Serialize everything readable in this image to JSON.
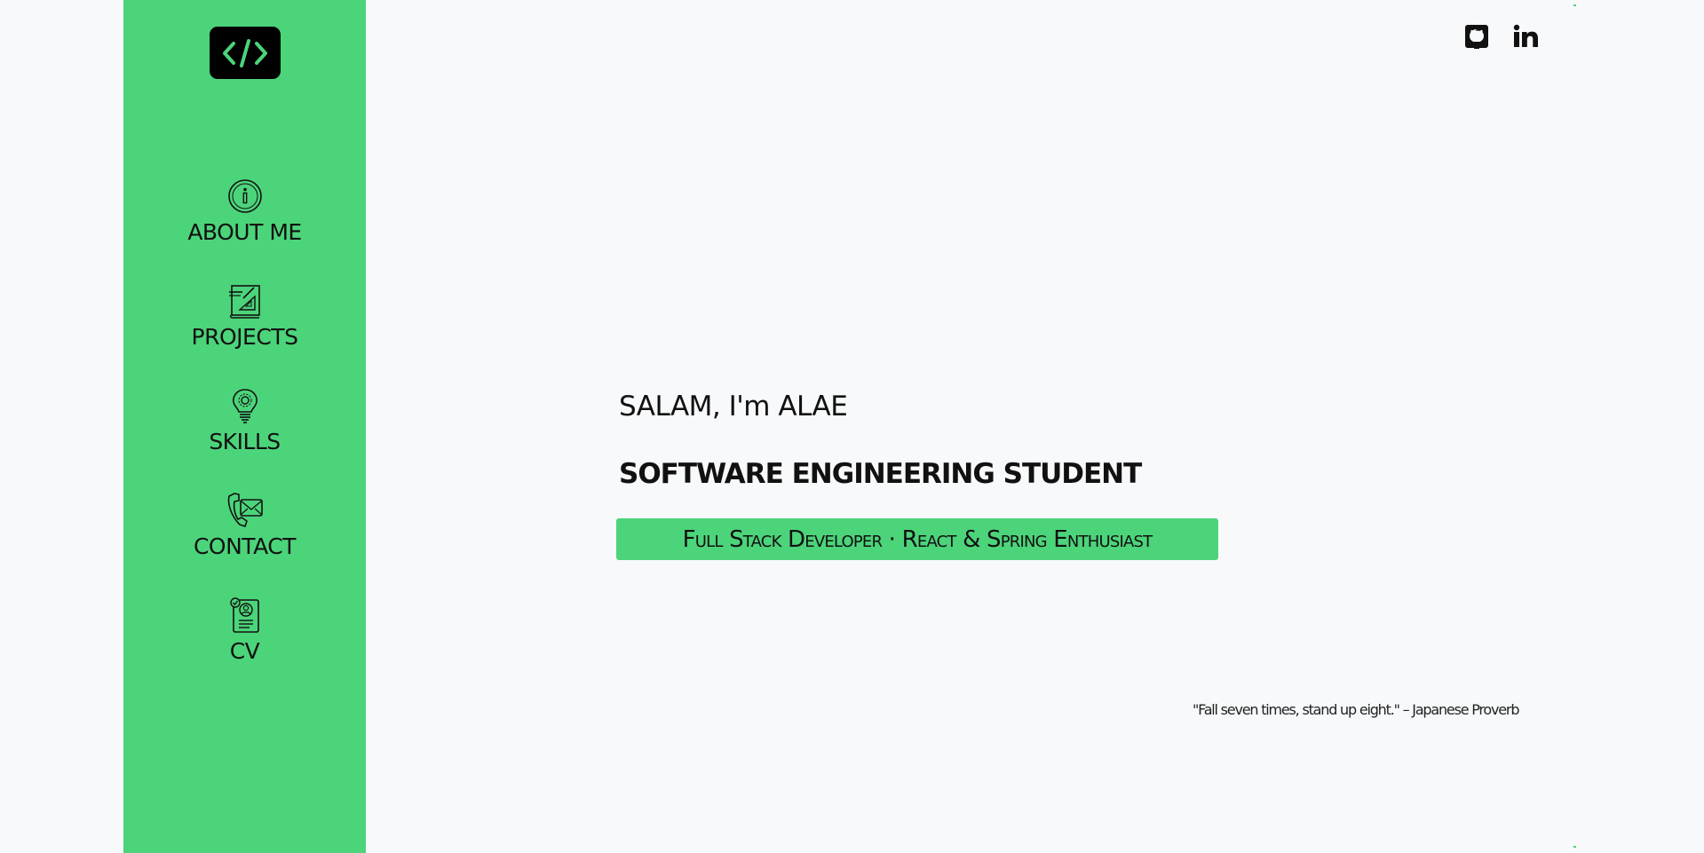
{
  "brand": {
    "logo_icon": "code-brackets-icon",
    "accent_color": "#4cd47a"
  },
  "sidebar": {
    "items": [
      {
        "label": "ABOUT ME",
        "icon": "info-icon"
      },
      {
        "label": "PROJECTS",
        "icon": "blueprint-icon"
      },
      {
        "label": "SKILLS",
        "icon": "lightbulb-gear-icon"
      },
      {
        "label": "CONTACT",
        "icon": "phone-mail-icon"
      },
      {
        "label": "CV",
        "icon": "resume-icon"
      }
    ]
  },
  "socials": {
    "items": [
      {
        "name": "GitHub",
        "icon": "github-icon"
      },
      {
        "name": "LinkedIn",
        "icon": "linkedin-icon"
      }
    ]
  },
  "hero": {
    "greeting": "SALAM, I'm ALAE",
    "role": "SOFTWARE ENGINEERING STUDENT",
    "tagline": "Full Stack Developer · React & Spring Enthusiast"
  },
  "quote": {
    "text": "\"Fall seven times, stand up eight.\" – Japanese Proverb"
  }
}
